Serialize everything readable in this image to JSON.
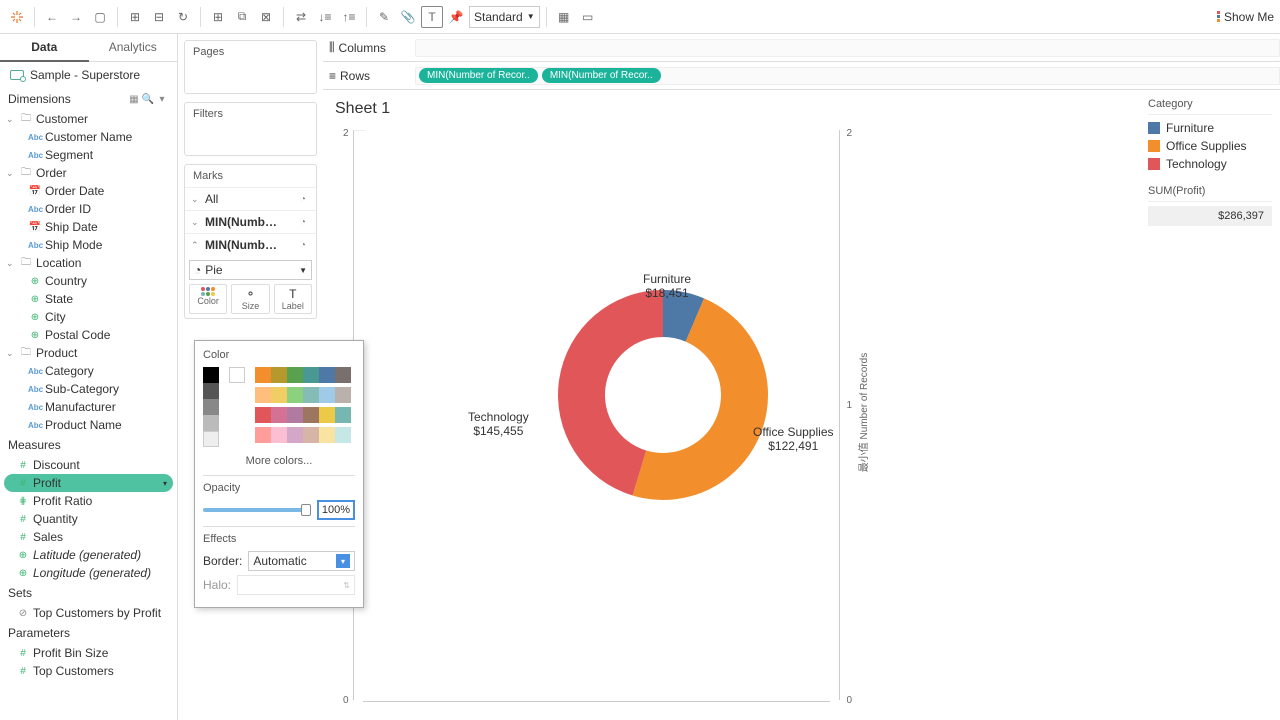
{
  "toolbar": {
    "fit": "Standard",
    "showme": "Show Me"
  },
  "tabs": {
    "data": "Data",
    "analytics": "Analytics"
  },
  "datasource": "Sample - Superstore",
  "dimensions_hdr": "Dimensions",
  "dimensions": {
    "customer": {
      "label": "Customer",
      "items": [
        "Customer Name",
        "Segment"
      ]
    },
    "order": {
      "label": "Order",
      "items": [
        "Order Date",
        "Order ID",
        "Ship Date",
        "Ship Mode"
      ]
    },
    "location": {
      "label": "Location",
      "items": [
        "Country",
        "State",
        "City",
        "Postal Code"
      ]
    },
    "product": {
      "label": "Product",
      "items": [
        "Category",
        "Sub-Category",
        "Manufacturer",
        "Product Name"
      ]
    }
  },
  "measures_hdr": "Measures",
  "measures": [
    "Discount",
    "Profit",
    "Profit Ratio",
    "Quantity",
    "Sales",
    "Latitude (generated)",
    "Longitude (generated)"
  ],
  "sets_hdr": "Sets",
  "sets": [
    "Top Customers by Profit"
  ],
  "params_hdr": "Parameters",
  "params": [
    "Profit Bin Size",
    "Top Customers"
  ],
  "shelves": {
    "pages": "Pages",
    "filters": "Filters",
    "marks": "Marks",
    "all": "All",
    "m1": "MIN(Numb…",
    "m2": "MIN(Numb…",
    "pie": "Pie",
    "color": "Color",
    "size": "Size",
    "label": "Label"
  },
  "colrows": {
    "columns": "Columns",
    "rows": "Rows",
    "pill1": "MIN(Number of Recor..",
    "pill2": "MIN(Number of Recor.."
  },
  "sheet_title": "Sheet 1",
  "axis": {
    "t2l": "2",
    "t0l": "0",
    "t2r": "2",
    "t1r": "1",
    "t0r": "0",
    "rtitle": "最小值 Number of Records"
  },
  "legend": {
    "hdr": "Category",
    "i1": "Furniture",
    "i2": "Office Supplies",
    "i3": "Technology",
    "sum_hdr": "SUM(Profit)",
    "sum_val": "$286,397"
  },
  "popup": {
    "color": "Color",
    "more": "More colors...",
    "opacity": "Opacity",
    "opval": "100%",
    "effects": "Effects",
    "border": "Border:",
    "border_val": "Automatic",
    "halo": "Halo:"
  },
  "chart_data": {
    "type": "pie",
    "title": "Sheet 1",
    "series": [
      {
        "name": "Furniture",
        "value": 18451,
        "label": "$18,451",
        "color": "#4e79a7"
      },
      {
        "name": "Office Supplies",
        "value": 122491,
        "label": "$122,491",
        "color": "#f28e2b"
      },
      {
        "name": "Technology",
        "value": 145455,
        "label": "$145,455",
        "color": "#e15759"
      }
    ],
    "total": 286397,
    "donut_inner_ratio": 0.55
  }
}
